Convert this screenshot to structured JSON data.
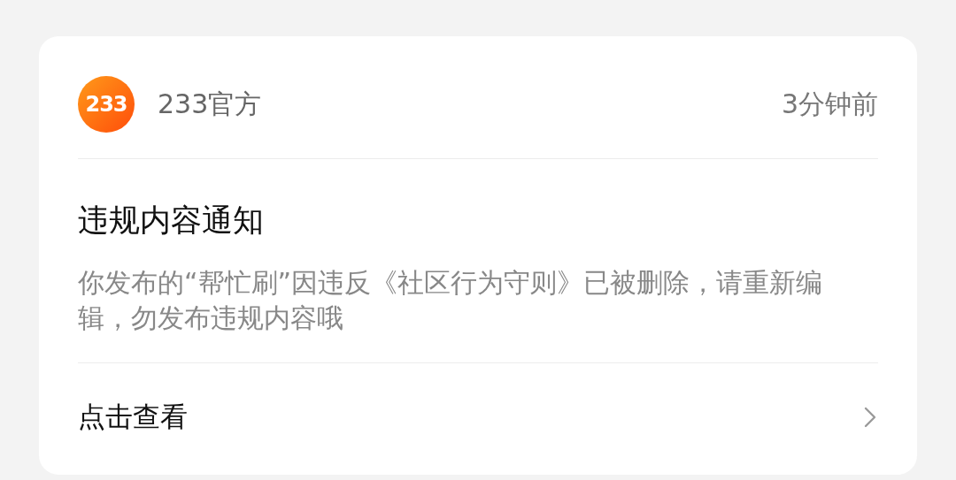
{
  "notification": {
    "sender": {
      "logo_text": "233",
      "name": "233官方"
    },
    "time": "3分钟前",
    "title": "违规内容通知",
    "message": "你发布的“帮忙刷”因违反《社区行为守则》已被删除，请重新编辑，勿发布违规内容哦",
    "action": "点击查看"
  }
}
